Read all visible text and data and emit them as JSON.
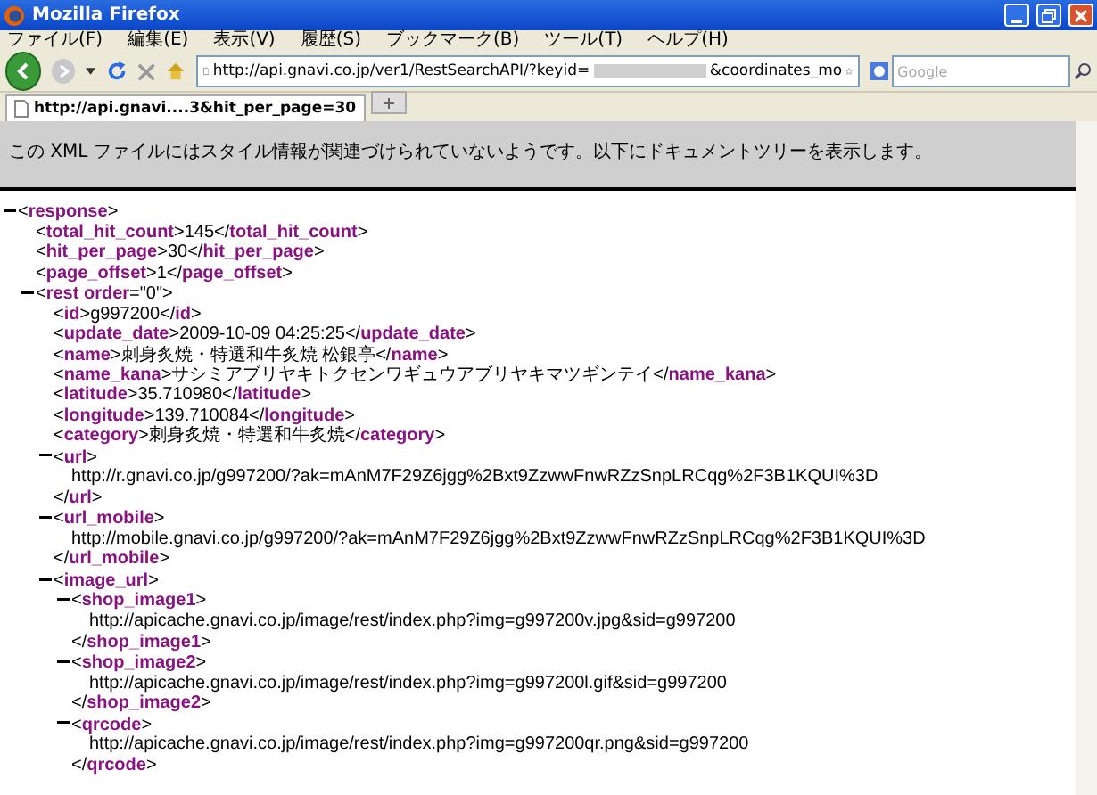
{
  "window": {
    "title": "Mozilla Firefox"
  },
  "menu": [
    "ファイル(F)",
    "編集(E)",
    "表示(V)",
    "履歴(S)",
    "ブックマーク(B)",
    "ツール(T)",
    "ヘルプ(H)"
  ],
  "address_bar": {
    "url_start": "http://api.gnavi.co.jp/ver1/RestSearchAPI/?keyid=",
    "url_end": "&coordinates_mo"
  },
  "search": {
    "placeholder": "Google"
  },
  "tabs": [
    {
      "label": "http://api.gnavi....3&hit_per_page=30",
      "selected": true
    }
  ],
  "notice": "この XML ファイルにはスタイル情報が関連づけられていないようです。以下にドキュメントツリーを表示します。",
  "tree": [
    {
      "open": "<**response**>",
      "expanded": true,
      "children": [
        {
          "open": "<**total_hit_count**>",
          "text": "145",
          "close": "</**total_hit_count**>"
        },
        {
          "open": "<**hit_per_page**>",
          "text": "30",
          "close": "</**hit_per_page**>"
        },
        {
          "open": "<**page_offset**>",
          "text": "1",
          "close": "</**page_offset**>"
        },
        {
          "open": "<**rest order**=\"0\">",
          "expanded": true,
          "children": [
            {
              "open": "<**id**>",
              "text": "g997200",
              "close": "</**id**>"
            },
            {
              "open": "<**update_date**>",
              "text": "2009-10-09 04:25:25",
              "close": "</**update_date**>"
            },
            {
              "open": "<**name**>",
              "text": "刺身炙焼・特選和牛炙焼 松銀亭",
              "close": "</**name**>"
            },
            {
              "open": "<**name_kana**>",
              "text": "サシミアブリヤキトクセンワギュウアブリヤキマツギンテイ",
              "close": "</**name_kana**>"
            },
            {
              "open": "<**latitude**>",
              "text": "35.710980",
              "close": "</**latitude**>"
            },
            {
              "open": "<**longitude**>",
              "text": "139.710084",
              "close": "</**longitude**>"
            },
            {
              "open": "<**category**>",
              "text": "刺身炙焼・特選和牛炙焼",
              "close": "</**category**>"
            },
            {
              "open": "<**url**>",
              "expanded": true,
              "children": [
                {
                  "text": "http://r.gnavi.co.jp/g997200/?ak=mAnM7F29Z6jgg%2Bxt9ZzwwFnwRZzSnpLRCqg%2F3B1KQUI%3D"
                }
              ],
              "close": "</**url**>"
            },
            {
              "open": "<**url_mobile**>",
              "expanded": true,
              "children": [
                {
                  "text": "http://mobile.gnavi.co.jp/g997200/?ak=mAnM7F29Z6jgg%2Bxt9ZzwwFnwRZzSnpLRCqg%2F3B1KQUI%3D"
                }
              ],
              "close": "</**url_mobile**>"
            },
            {
              "open": "<**image_url**>",
              "expanded": true,
              "children": [
                {
                  "open": "<**shop_image1**>",
                  "expanded": true,
                  "children": [
                    {
                      "text": "http://apicache.gnavi.co.jp/image/rest/index.php?img=g997200v.jpg&sid=g997200"
                    }
                  ],
                  "close": "</**shop_image1**>"
                },
                {
                  "open": "<**shop_image2**>",
                  "expanded": true,
                  "children": [
                    {
                      "text": "http://apicache.gnavi.co.jp/image/rest/index.php?img=g997200l.gif&sid=g997200"
                    }
                  ],
                  "close": "</**shop_image2**>"
                },
                {
                  "open": "<**qrcode**>",
                  "expanded": true,
                  "children": [
                    {
                      "text": "http://apicache.gnavi.co.jp/image/rest/index.php?img=g997200qr.png&sid=g997200"
                    }
                  ],
                  "close": "</**qrcode**>"
                }
              ]
            }
          ]
        }
      ]
    }
  ]
}
